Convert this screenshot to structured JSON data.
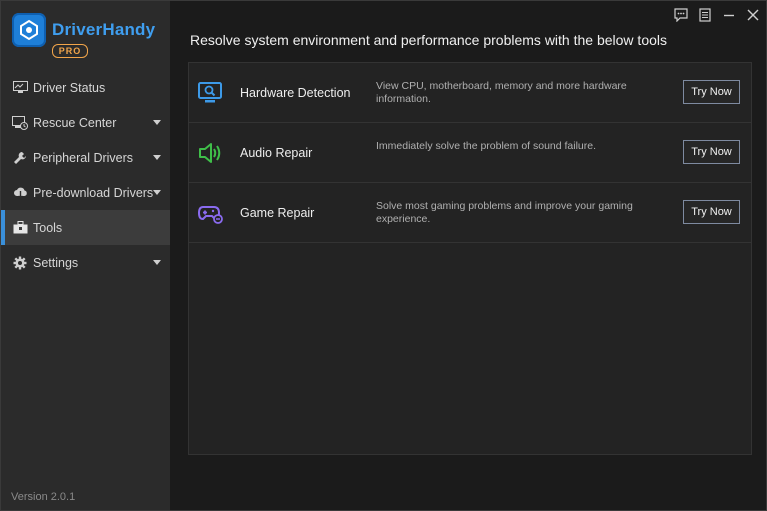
{
  "app": {
    "name": "DriverHandy",
    "edition": "PRO",
    "version": "Version 2.0.1"
  },
  "titlebar": {
    "icons": [
      "feedback-icon",
      "menu-icon",
      "minimize-icon",
      "close-icon"
    ]
  },
  "sidebar": {
    "items": [
      {
        "label": "Driver Status",
        "icon": "monitor-icon",
        "expandable": false,
        "active": false
      },
      {
        "label": "Rescue Center",
        "icon": "restore-icon",
        "expandable": true,
        "active": false
      },
      {
        "label": "Peripheral Drivers",
        "icon": "wrench-icon",
        "expandable": true,
        "active": false
      },
      {
        "label": "Pre-download Drivers",
        "icon": "cloud-download-icon",
        "expandable": true,
        "active": false
      },
      {
        "label": "Tools",
        "icon": "toolbox-icon",
        "expandable": false,
        "active": true
      },
      {
        "label": "Settings",
        "icon": "gear-icon",
        "expandable": true,
        "active": false
      }
    ]
  },
  "main": {
    "heading": "Resolve system environment and performance problems with the below tools",
    "tools": [
      {
        "title": "Hardware Detection",
        "description": "View CPU, motherboard, memory and more hardware information.",
        "button": "Try Now",
        "icon": "hardware-scan-icon",
        "color": "#3d9ae8"
      },
      {
        "title": "Audio Repair",
        "description": "Immediately solve the problem of sound failure.",
        "button": "Try Now",
        "icon": "speaker-icon",
        "color": "#3fbe49"
      },
      {
        "title": "Game Repair",
        "description": "Solve most gaming problems and improve your gaming experience.",
        "button": "Try Now",
        "icon": "gamepad-icon",
        "color": "#8a6bf0"
      }
    ]
  },
  "colors": {
    "accent": "#3a8fd9",
    "sidebar_bg": "#2b2b2b",
    "main_bg": "#1b1b1b"
  }
}
